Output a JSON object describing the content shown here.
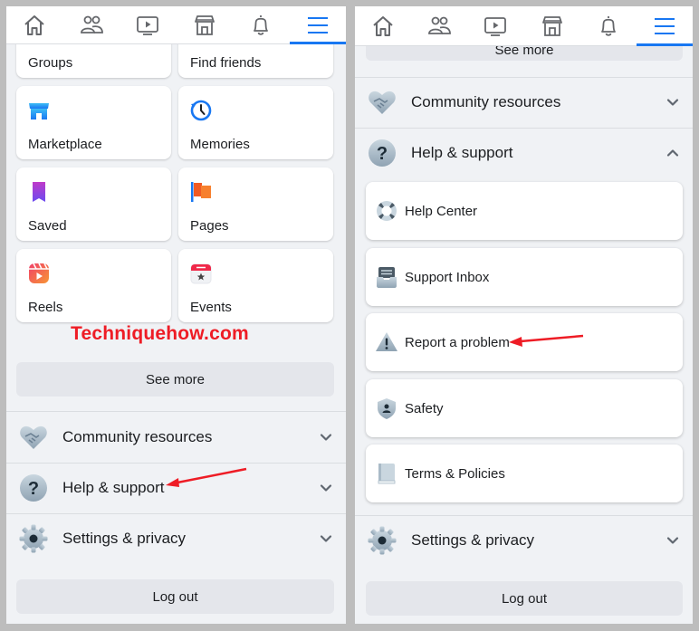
{
  "watermark": "Techniquehow.com",
  "colors": {
    "accent": "#1877f2",
    "annotation": "#ee1c25",
    "background": "#f0f2f5",
    "card": "#ffffff",
    "button": "#e4e6eb"
  },
  "nav": {
    "tabs": [
      {
        "name": "home",
        "icon": "home-icon"
      },
      {
        "name": "friends",
        "icon": "friends-icon"
      },
      {
        "name": "watch",
        "icon": "video-icon"
      },
      {
        "name": "marketplace",
        "icon": "store-icon"
      },
      {
        "name": "notifications",
        "icon": "bell-icon"
      },
      {
        "name": "menu",
        "icon": "hamburger-menu-icon",
        "active": true
      }
    ]
  },
  "left": {
    "shortcuts": [
      {
        "label": "Groups",
        "icon": "groups-icon"
      },
      {
        "label": "Find friends",
        "icon": "find-friends-icon"
      },
      {
        "label": "Marketplace",
        "icon": "marketplace-icon"
      },
      {
        "label": "Memories",
        "icon": "memories-icon"
      },
      {
        "label": "Saved",
        "icon": "saved-icon"
      },
      {
        "label": "Pages",
        "icon": "pages-icon"
      },
      {
        "label": "Reels",
        "icon": "reels-icon"
      },
      {
        "label": "Events",
        "icon": "events-icon"
      }
    ],
    "see_more": "See more",
    "sections": [
      {
        "label": "Community resources",
        "icon": "handshake-icon",
        "expanded": false
      },
      {
        "label": "Help & support",
        "icon": "question-icon",
        "expanded": false
      },
      {
        "label": "Settings & privacy",
        "icon": "gear-icon",
        "expanded": false
      }
    ],
    "logout": "Log out"
  },
  "right": {
    "see_more": "See more",
    "sections": [
      {
        "label": "Community resources",
        "icon": "handshake-icon",
        "expanded": false
      },
      {
        "label": "Help & support",
        "icon": "question-icon",
        "expanded": true
      },
      {
        "label": "Settings & privacy",
        "icon": "gear-icon",
        "expanded": false
      }
    ],
    "help_items": [
      {
        "label": "Help Center",
        "icon": "lifebuoy-icon"
      },
      {
        "label": "Support Inbox",
        "icon": "inbox-icon"
      },
      {
        "label": "Report a problem",
        "icon": "warning-icon"
      },
      {
        "label": "Safety",
        "icon": "shield-icon"
      },
      {
        "label": "Terms & Policies",
        "icon": "book-icon"
      }
    ],
    "logout": "Log out"
  }
}
